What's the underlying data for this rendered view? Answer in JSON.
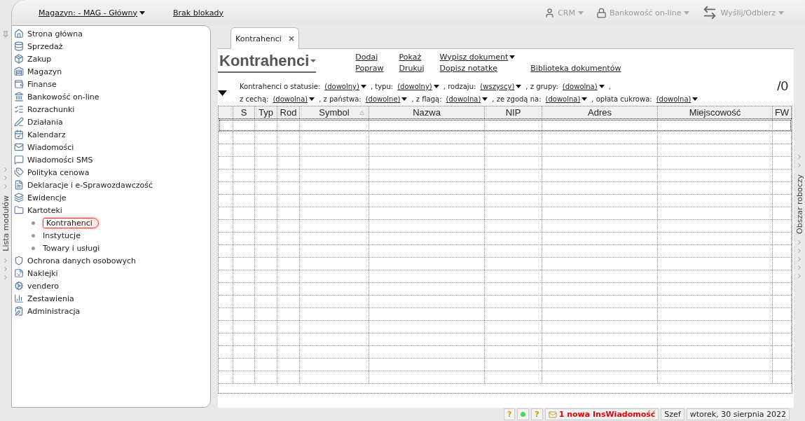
{
  "topbar": {
    "warehouse": "Magazyn: - MAG - Główny",
    "lock": "Brak blokady",
    "tools": [
      {
        "label": "CRM"
      },
      {
        "label": "Bankowość on-line"
      },
      {
        "label": "Wyślij/Odbierz"
      }
    ]
  },
  "left_rail": {
    "label": "Lista modułów"
  },
  "right_rail": {
    "label": "Obszar roboczy"
  },
  "sidebar": {
    "items": [
      {
        "label": "Strona główna",
        "selected": false
      },
      {
        "label": "Sprzedaż",
        "selected": false
      },
      {
        "label": "Zakup",
        "selected": false
      },
      {
        "label": "Magazyn",
        "selected": false
      },
      {
        "label": "Finanse",
        "selected": false
      },
      {
        "label": "Bankowość on-line",
        "selected": false
      },
      {
        "label": "Rozrachunki",
        "selected": false
      },
      {
        "label": "Działania",
        "selected": false
      },
      {
        "label": "Kalendarz",
        "selected": false
      },
      {
        "label": "Wiadomości",
        "selected": false
      },
      {
        "label": "Wiadomości SMS",
        "selected": false
      },
      {
        "label": "Polityka cenowa",
        "selected": false
      },
      {
        "label": "Deklaracje i e-Sprawozdawczość",
        "selected": false
      },
      {
        "label": "Ewidencje",
        "selected": false
      },
      {
        "label": "Kartoteki",
        "selected": false,
        "children": [
          {
            "label": "Kontrahenci",
            "selected": true
          },
          {
            "label": "Instytucje",
            "selected": false
          },
          {
            "label": "Towary i usługi",
            "selected": false
          }
        ]
      },
      {
        "label": "Ochrona danych osobowych",
        "selected": false
      },
      {
        "label": "Naklejki",
        "selected": false
      },
      {
        "label": "vendero",
        "selected": false
      },
      {
        "label": "Zestawienia",
        "selected": false
      },
      {
        "label": "Administracja",
        "selected": false
      }
    ]
  },
  "tabs": [
    {
      "label": "Kontrahenci",
      "selected": true
    }
  ],
  "page": {
    "title": "Kontrahenci",
    "count": "/0",
    "actions": [
      [
        "Dodaj",
        "Popraw"
      ],
      [
        "Pokaż",
        "Drukuj"
      ],
      [
        "Wypisz dokument",
        "Dopisz notatkę"
      ],
      [
        "Biblioteka dokumentów"
      ]
    ],
    "filters": [
      [
        {
          "prefix": "Kontrahenci o statusie:",
          "value": "(dowolny)"
        },
        {
          "prefix": ", typu:",
          "value": "(dowolny)"
        },
        {
          "prefix": ", rodzaju:",
          "value": "(wszyscy)"
        },
        {
          "prefix": ", z grupy:",
          "value": "(dowolna)",
          "suffix": ","
        }
      ],
      [
        {
          "prefix": "z cechą:",
          "value": "(dowolna)"
        },
        {
          "prefix": ", z państwa:",
          "value": "(dowolne)"
        },
        {
          "prefix": ", z flagą:",
          "value": "(dowolna)"
        },
        {
          "prefix": ", ze zgodą na:",
          "value": "(dowolna)"
        },
        {
          "prefix": ", opłata cukrowa:",
          "value": "(dowolna)"
        }
      ]
    ]
  },
  "table": {
    "columns": [
      "S",
      "Typ",
      "Rod",
      "Symbol",
      "Nazwa",
      "NIP",
      "Adres",
      "Miejscowość",
      "FW"
    ]
  },
  "status_bar": {
    "help_marks": [
      "?",
      "?"
    ],
    "message": "1 nowa InsWiadomość",
    "user": "Szef",
    "date": "wtorek, 30 sierpnia 2022"
  }
}
